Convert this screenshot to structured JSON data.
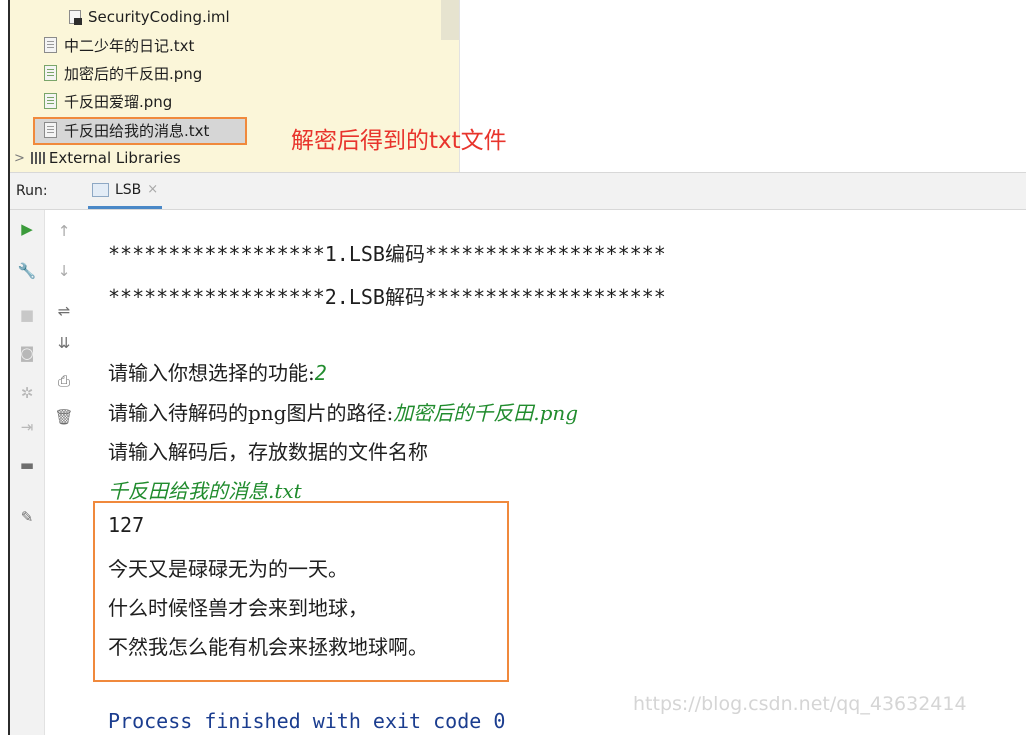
{
  "project_tree": {
    "items": [
      {
        "label": "SecurityCoding.iml",
        "icon": "iml-file-icon"
      },
      {
        "label": "中二少年的日记.txt",
        "icon": "text-file-icon"
      },
      {
        "label": "加密后的千反田.png",
        "icon": "image-file-icon"
      },
      {
        "label": "千反田爱瑠.png",
        "icon": "image-file-icon"
      },
      {
        "label": "千反田给我的消息.txt",
        "icon": "text-file-icon",
        "selected": true
      }
    ],
    "external_libraries": "External Libraries",
    "annotation": "解密后得到的txt文件"
  },
  "run_panel": {
    "label": "Run:",
    "tab_label": "LSB",
    "close_glyph": "×"
  },
  "console": {
    "menu_line_1": "******************1.LSB编码********************",
    "menu_line_2": "******************2.LSB解码********************",
    "prompt_function": "请输入你想选择的功能:",
    "function_input": "2",
    "prompt_path": "请输入待解码的png图片的路径:",
    "path_input": "加密后的千反田.png",
    "prompt_filename": "请输入解码后，存放数据的文件名称",
    "filename_input": "千反田给我的消息.txt",
    "result_lines": [
      "127",
      "今天又是碌碌无为的一天。",
      "什么时候怪兽才会来到地球，",
      "不然我怎么能有机会来拯救地球啊。"
    ],
    "exit_line": "Process finished with exit code 0"
  },
  "watermark": "https://blog.csdn.net/qq_43632414",
  "colors": {
    "highlight_border": "#f0893c",
    "annotation_red": "#e8342c",
    "user_input_green": "#218c2e",
    "exit_blue": "#1b3d8f",
    "tree_background": "#fbf6d9"
  }
}
